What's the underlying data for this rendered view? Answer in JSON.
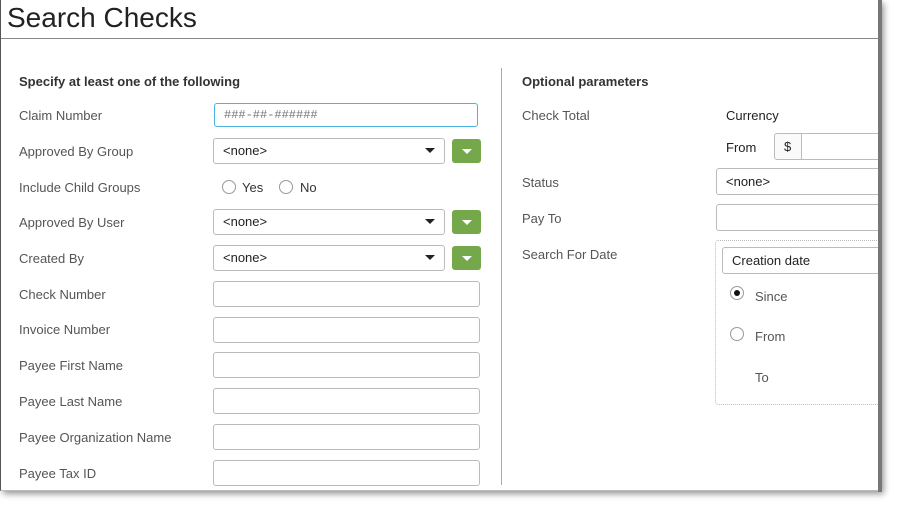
{
  "title": "Search Checks",
  "left": {
    "heading": "Specify at least one of the following",
    "claim_number": {
      "label": "Claim Number",
      "placeholder": "###-##-######"
    },
    "approved_by_group": {
      "label": "Approved By Group",
      "value": "<none>"
    },
    "include_child_groups": {
      "label": "Include Child Groups",
      "yes": "Yes",
      "no": "No"
    },
    "approved_by_user": {
      "label": "Approved By User",
      "value": "<none>"
    },
    "created_by": {
      "label": "Created By",
      "value": "<none>"
    },
    "text_fields": [
      "Check Number",
      "Invoice Number",
      "Payee First Name",
      "Payee Last Name",
      "Payee Organization Name",
      "Payee Tax ID"
    ]
  },
  "right": {
    "heading": "Optional parameters",
    "check_total": {
      "label": "Check Total",
      "currency": "Currency",
      "from": "From",
      "symbol": "$"
    },
    "status": {
      "label": "Status",
      "value": "<none>"
    },
    "pay_to": {
      "label": "Pay To"
    },
    "search_for_date": {
      "label": "Search For Date",
      "value": "Creation date",
      "since": "Since",
      "from": "From",
      "to": "To",
      "selected": "Since"
    }
  },
  "colors": {
    "accent_button": "#74a84a",
    "focus": "#4ab3e6"
  }
}
